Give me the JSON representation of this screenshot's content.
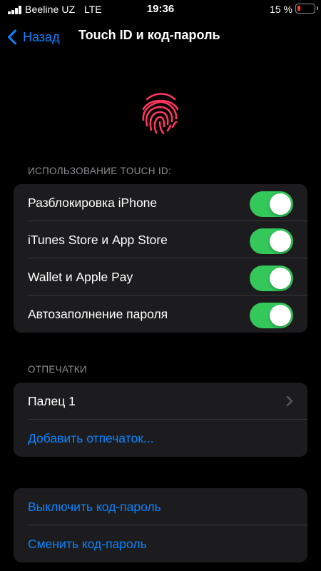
{
  "status_bar": {
    "carrier": "Beeline UZ",
    "network": "LTE",
    "time": "19:36",
    "battery_percent": "15 %",
    "battery_level": 0.15,
    "battery_color": "#ff3b30"
  },
  "nav": {
    "back_label": "Назад",
    "title": "Touch ID и код-пароль"
  },
  "touch_id_section": {
    "header": "ИСПОЛЬЗОВАНИЕ TOUCH ID:",
    "items": [
      {
        "label": "Разблокировка iPhone",
        "enabled": true
      },
      {
        "label": "iTunes Store и App Store",
        "enabled": true
      },
      {
        "label": "Wallet и Apple Pay",
        "enabled": true
      },
      {
        "label": "Автозаполнение пароля",
        "enabled": true
      }
    ]
  },
  "fingerprints_section": {
    "header": "ОТПЕЧАТКИ",
    "finger_label": "Палец 1",
    "add_label": "Добавить отпечаток..."
  },
  "passcode_section": {
    "turn_off_label": "Выключить код-пароль",
    "change_label": "Сменить код-пароль"
  },
  "colors": {
    "accent": "#0a84ff",
    "toggle_on": "#34c759",
    "fingerprint": "#ff375f",
    "cell_background": "#1c1c1e"
  }
}
